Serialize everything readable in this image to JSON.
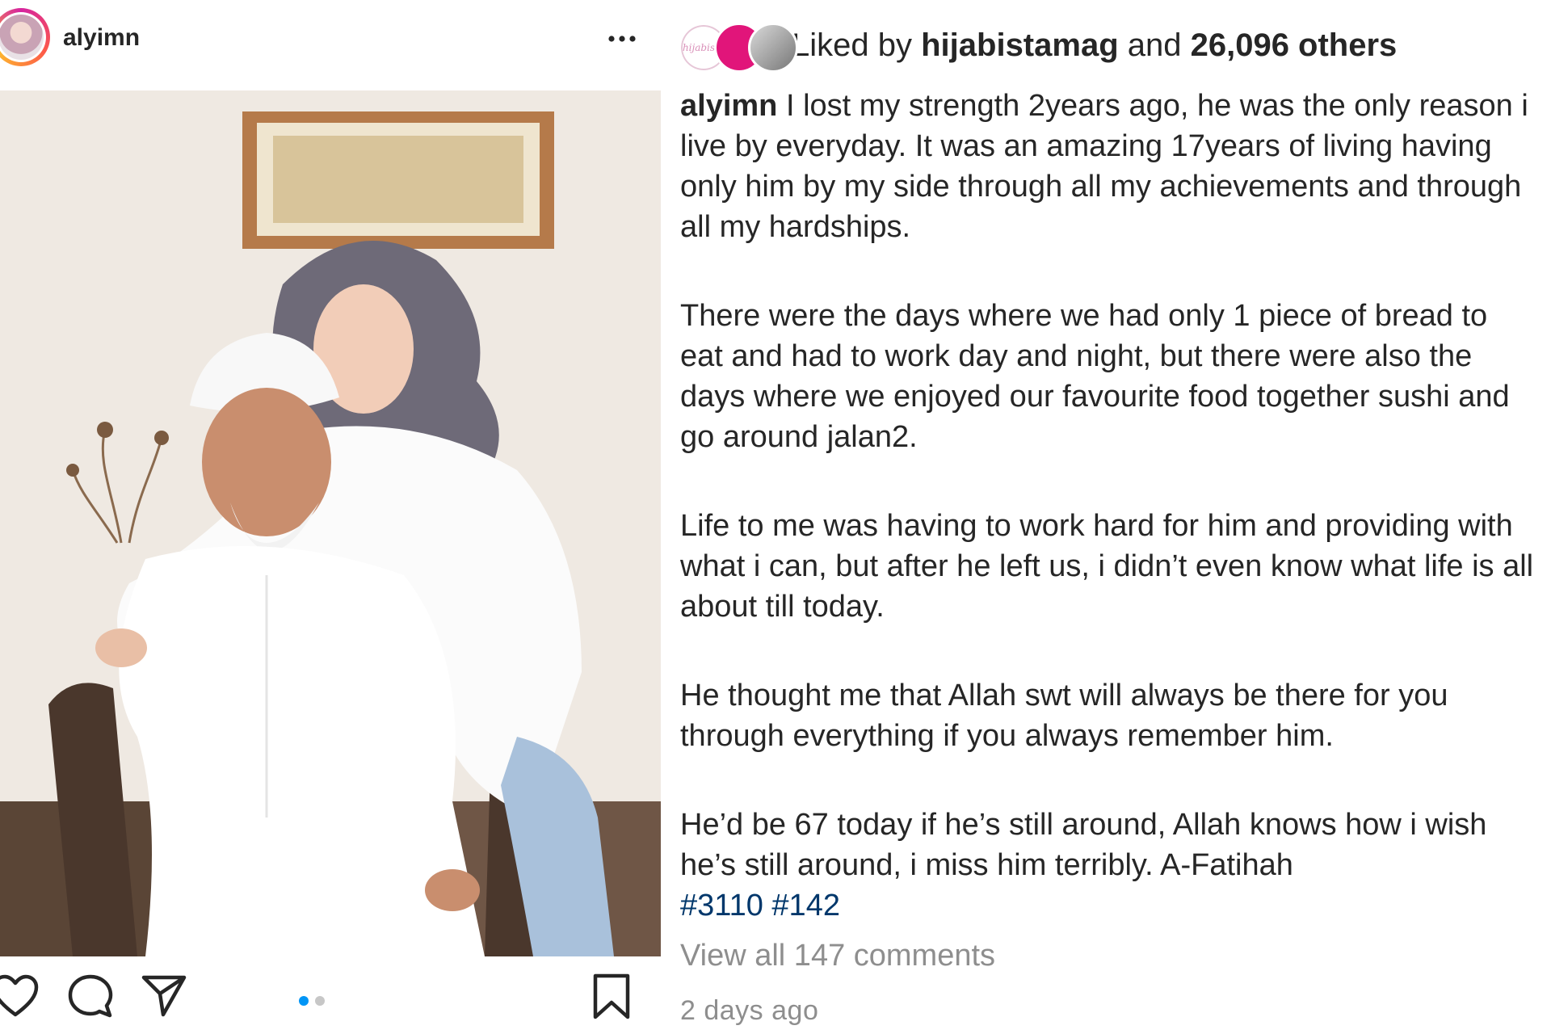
{
  "post": {
    "username": "alyimn",
    "more_icon": "more-horizontal-icon",
    "photo_alt": "",
    "carousel": {
      "count": 2,
      "active": 0
    }
  },
  "actions": {
    "like_icon": "heart-icon",
    "comment_icon": "comment-icon",
    "share_icon": "paper-plane-icon",
    "save_icon": "bookmark-icon"
  },
  "likes": {
    "prefix": "Liked by ",
    "user": "hijabistamag",
    "middle": " and ",
    "count": "26,096 others",
    "avatar1_text": "hijabista"
  },
  "caption": {
    "user": "alyimn",
    "p1": " I lost my strength 2years ago, he was the only reason i live by everyday. It was an amazing 17years of living having only him by my side through all my achievements and through all my hardships.",
    "p2": "There were the days where we had only 1 piece of bread to eat and had to work day and night, but there were also the days where we enjoyed our favourite food together sushi and go around jalan2.",
    "p3": "Life to me was having to work hard for him and providing with what i can, but after he left us, i didn’t even know what life is all about till today.",
    "p4": "He thought me that Allah swt will always be there for you through everything if you always remember him.",
    "p5": "He’d be 67 today if he’s still around, Allah knows how i wish he’s still around, i miss him terribly. A-Fatihah",
    "hashtags": [
      "#3110",
      "#142"
    ]
  },
  "comments": {
    "view_all": "View all 147 comments"
  },
  "timestamp": "2 days ago",
  "colors": {
    "text": "#262626",
    "muted": "#8e8e8e",
    "hashtag": "#00376b",
    "carousel_active": "#0095f6"
  }
}
